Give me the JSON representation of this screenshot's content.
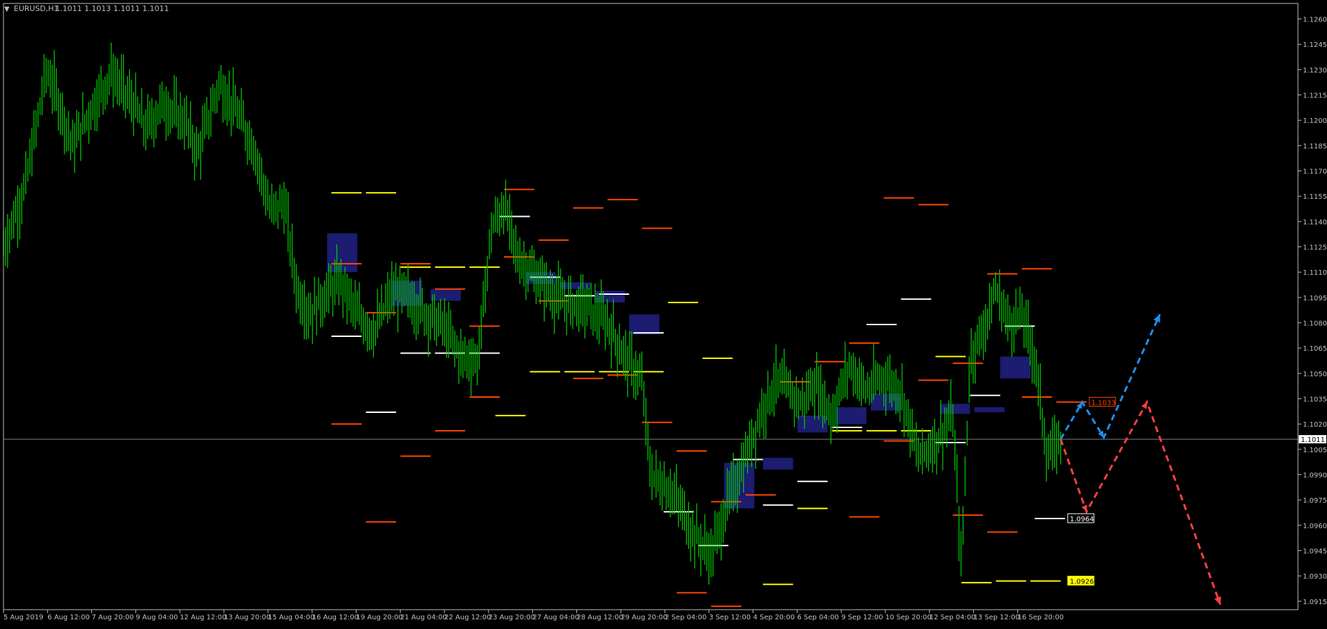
{
  "window": {
    "symbol_title": "EURUSD,H1",
    "ohlc_text": "1.1011 1.1013 1.1011 1.1011"
  },
  "colors": {
    "background": "#000000",
    "axis": "#c0c0c0",
    "candles": "#00c800",
    "bid_line": "#808080",
    "zone_fill": "#1c1c70",
    "level_orange": "#ff4500",
    "level_yellow": "#ffff00",
    "level_white": "#ffffff",
    "path_blue": "#1e8ff0",
    "path_red": "#ff4040"
  },
  "chart_data": {
    "type": "candlestick",
    "symbol": "EURUSD",
    "timeframe": "H1",
    "xlabel": "",
    "ylabel": "",
    "ylim": [
      1.091,
      1.1268
    ],
    "y_ticks": [
      "1.1260",
      "1.1245",
      "1.1230",
      "1.1215",
      "1.1200",
      "1.1185",
      "1.1170",
      "1.1155",
      "1.1140",
      "1.1125",
      "1.1110",
      "1.1095",
      "1.1080",
      "1.1065",
      "1.1050",
      "1.1035",
      "1.1020",
      "1.1005",
      "1.0990",
      "1.0975",
      "1.0960",
      "1.0945",
      "1.0930",
      "1.0915"
    ],
    "x_ticks": [
      "5 Aug 2019",
      "6 Aug 12:00",
      "7 Aug 20:00",
      "9 Aug 04:00",
      "12 Aug 12:00",
      "13 Aug 20:00",
      "15 Aug 04:00",
      "16 Aug 12:00",
      "19 Aug 20:00",
      "21 Aug 04:00",
      "22 Aug 12:00",
      "23 Aug 20:00",
      "27 Aug 04:00",
      "28 Aug 12:00",
      "29 Aug 20:00",
      "2 Sep 04:00",
      "3 Sep 12:00",
      "4 Sep 20:00",
      "6 Sep 04:00",
      "9 Sep 12:00",
      "10 Sep 20:00",
      "12 Sep 04:00",
      "13 Sep 12:00",
      "16 Sep 20:00"
    ],
    "x_range": [
      0,
      30
    ],
    "current_price": "1.1011",
    "price_path": [
      [
        0,
        1.1125
      ],
      [
        0.5,
        1.116
      ],
      [
        1.0,
        1.123
      ],
      [
        1.3,
        1.121
      ],
      [
        1.6,
        1.1185
      ],
      [
        2.0,
        1.1205
      ],
      [
        2.5,
        1.1228
      ],
      [
        3.0,
        1.121
      ],
      [
        3.3,
        1.1195
      ],
      [
        3.7,
        1.121
      ],
      [
        4.2,
        1.12
      ],
      [
        4.5,
        1.118
      ],
      [
        5.0,
        1.1222
      ],
      [
        5.4,
        1.1205
      ],
      [
        5.8,
        1.1185
      ],
      [
        6.2,
        1.1145
      ],
      [
        6.5,
        1.1152
      ],
      [
        6.8,
        1.11
      ],
      [
        7.1,
        1.1085
      ],
      [
        7.4,
        1.1095
      ],
      [
        7.8,
        1.1105
      ],
      [
        8.2,
        1.1085
      ],
      [
        8.6,
        1.1075
      ],
      [
        9.0,
        1.1098
      ],
      [
        9.4,
        1.1095
      ],
      [
        9.8,
        1.1085
      ],
      [
        10.2,
        1.1078
      ],
      [
        10.6,
        1.106
      ],
      [
        11.0,
        1.1058
      ],
      [
        11.3,
        1.1135
      ],
      [
        11.6,
        1.115
      ],
      [
        11.9,
        1.112
      ],
      [
        12.3,
        1.1108
      ],
      [
        12.7,
        1.1098
      ],
      [
        13.0,
        1.1092
      ],
      [
        13.5,
        1.109
      ],
      [
        14.0,
        1.108
      ],
      [
        14.4,
        1.106
      ],
      [
        14.8,
        1.1045
      ],
      [
        15.0,
        1.099
      ],
      [
        15.5,
        1.098
      ],
      [
        16.0,
        1.0955
      ],
      [
        16.4,
        1.0942
      ],
      [
        16.8,
        1.0975
      ],
      [
        17.2,
        1.1
      ],
      [
        17.6,
        1.103
      ],
      [
        17.9,
        1.1045
      ],
      [
        18.2,
        1.104
      ],
      [
        18.5,
        1.1032
      ],
      [
        18.8,
        1.1045
      ],
      [
        19.2,
        1.1025
      ],
      [
        19.6,
        1.1055
      ],
      [
        20.0,
        1.104
      ],
      [
        20.4,
        1.1048
      ],
      [
        20.8,
        1.104
      ],
      [
        21.2,
        1.1
      ],
      [
        21.6,
        1.101
      ],
      [
        22.0,
        1.1025
      ],
      [
        22.2,
        1.0935
      ],
      [
        22.4,
        1.106
      ],
      [
        22.7,
        1.1075
      ],
      [
        23.0,
        1.11
      ],
      [
        23.3,
        1.108
      ],
      [
        23.6,
        1.1085
      ],
      [
        23.9,
        1.106
      ],
      [
        24.2,
        1.1
      ],
      [
        24.5,
        1.1011
      ]
    ],
    "demand_supply_zones": [
      {
        "x0": 7.5,
        "x1": 8.2,
        "y0": 1.111,
        "y1": 1.1133
      },
      {
        "x0": 9.0,
        "x1": 9.7,
        "y0": 1.109,
        "y1": 1.1105
      },
      {
        "x0": 9.9,
        "x1": 10.6,
        "y0": 1.1093,
        "y1": 1.11
      },
      {
        "x0": 12.1,
        "x1": 12.8,
        "y0": 1.1103,
        "y1": 1.111
      },
      {
        "x0": 12.9,
        "x1": 13.6,
        "y0": 1.11,
        "y1": 1.1104
      },
      {
        "x0": 13.7,
        "x1": 14.4,
        "y0": 1.1092,
        "y1": 1.1099
      },
      {
        "x0": 14.5,
        "x1": 15.2,
        "y0": 1.1073,
        "y1": 1.1085
      },
      {
        "x0": 16.7,
        "x1": 17.4,
        "y0": 1.097,
        "y1": 1.0997
      },
      {
        "x0": 17.6,
        "x1": 18.3,
        "y0": 1.0993,
        "y1": 1.1
      },
      {
        "x0": 18.4,
        "x1": 19.1,
        "y0": 1.1015,
        "y1": 1.1025
      },
      {
        "x0": 19.3,
        "x1": 20.0,
        "y0": 1.102,
        "y1": 1.103
      },
      {
        "x0": 20.1,
        "x1": 20.8,
        "y0": 1.1028,
        "y1": 1.1038
      },
      {
        "x0": 21.7,
        "x1": 22.4,
        "y0": 1.1026,
        "y1": 1.1032
      },
      {
        "x0": 22.5,
        "x1": 23.2,
        "y0": 1.1027,
        "y1": 1.103
      },
      {
        "x0": 23.1,
        "x1": 23.8,
        "y0": 1.1047,
        "y1": 1.106
      }
    ],
    "levels": [
      {
        "color": "orange",
        "x0": 7.6,
        "x1": 8.3,
        "y": 1.1115
      },
      {
        "color": "orange",
        "x0": 7.6,
        "x1": 8.3,
        "y": 1.102
      },
      {
        "color": "orange",
        "x0": 8.4,
        "x1": 9.1,
        "y": 1.0962
      },
      {
        "color": "orange",
        "x0": 8.4,
        "x1": 9.1,
        "y": 1.1086
      },
      {
        "color": "orange",
        "x0": 9.2,
        "x1": 9.9,
        "y": 1.1115
      },
      {
        "color": "orange",
        "x0": 9.2,
        "x1": 9.9,
        "y": 1.1001
      },
      {
        "color": "orange",
        "x0": 10.0,
        "x1": 10.7,
        "y": 1.11
      },
      {
        "color": "orange",
        "x0": 10.0,
        "x1": 10.7,
        "y": 1.1016
      },
      {
        "color": "orange",
        "x0": 10.8,
        "x1": 11.5,
        "y": 1.1078
      },
      {
        "color": "orange",
        "x0": 10.8,
        "x1": 11.5,
        "y": 1.1036
      },
      {
        "color": "orange",
        "x0": 11.6,
        "x1": 12.3,
        "y": 1.1159
      },
      {
        "color": "orange",
        "x0": 11.6,
        "x1": 12.3,
        "y": 1.1119
      },
      {
        "color": "orange",
        "x0": 12.4,
        "x1": 13.1,
        "y": 1.1129
      },
      {
        "color": "orange",
        "x0": 12.4,
        "x1": 13.1,
        "y": 1.1093
      },
      {
        "color": "orange",
        "x0": 13.2,
        "x1": 13.9,
        "y": 1.1148
      },
      {
        "color": "orange",
        "x0": 13.2,
        "x1": 13.9,
        "y": 1.1047
      },
      {
        "color": "orange",
        "x0": 14.0,
        "x1": 14.7,
        "y": 1.1153
      },
      {
        "color": "orange",
        "x0": 14.0,
        "x1": 14.7,
        "y": 1.1049
      },
      {
        "color": "orange",
        "x0": 14.8,
        "x1": 15.5,
        "y": 1.1136
      },
      {
        "color": "orange",
        "x0": 14.8,
        "x1": 15.5,
        "y": 1.1021
      },
      {
        "color": "orange",
        "x0": 15.6,
        "x1": 16.3,
        "y": 1.1004
      },
      {
        "color": "orange",
        "x0": 15.6,
        "x1": 16.3,
        "y": 1.092
      },
      {
        "color": "orange",
        "x0": 16.4,
        "x1": 17.1,
        "y": 1.0974
      },
      {
        "color": "orange",
        "x0": 16.4,
        "x1": 17.1,
        "y": 1.0912
      },
      {
        "color": "orange",
        "x0": 17.2,
        "x1": 17.9,
        "y": 1.0978
      },
      {
        "color": "orange",
        "x0": 18.0,
        "x1": 18.7,
        "y": 1.1045
      },
      {
        "color": "orange",
        "x0": 18.8,
        "x1": 19.5,
        "y": 1.1057
      },
      {
        "color": "orange",
        "x0": 19.6,
        "x1": 20.3,
        "y": 1.1068
      },
      {
        "color": "orange",
        "x0": 19.6,
        "x1": 20.3,
        "y": 1.0965
      },
      {
        "color": "orange",
        "x0": 20.4,
        "x1": 21.1,
        "y": 1.1154
      },
      {
        "color": "orange",
        "x0": 20.4,
        "x1": 21.1,
        "y": 1.101
      },
      {
        "color": "orange",
        "x0": 21.2,
        "x1": 21.9,
        "y": 1.115
      },
      {
        "color": "orange",
        "x0": 21.2,
        "x1": 21.9,
        "y": 1.1046
      },
      {
        "color": "orange",
        "x0": 22.0,
        "x1": 22.7,
        "y": 1.1056
      },
      {
        "color": "orange",
        "x0": 22.0,
        "x1": 22.7,
        "y": 1.0966
      },
      {
        "color": "orange",
        "x0": 22.8,
        "x1": 23.5,
        "y": 1.1109
      },
      {
        "color": "orange",
        "x0": 22.8,
        "x1": 23.5,
        "y": 1.0956
      },
      {
        "color": "orange",
        "x0": 23.6,
        "x1": 24.3,
        "y": 1.1112
      },
      {
        "color": "orange",
        "x0": 23.6,
        "x1": 24.3,
        "y": 1.1036
      },
      {
        "color": "orange",
        "x0": 24.4,
        "x1": 25.1,
        "y": 1.1033
      },
      {
        "color": "yellow",
        "x0": 7.6,
        "x1": 8.3,
        "y": 1.1157
      },
      {
        "color": "yellow",
        "x0": 8.4,
        "x1": 9.1,
        "y": 1.1157
      },
      {
        "color": "yellow",
        "x0": 9.2,
        "x1": 9.9,
        "y": 1.1113
      },
      {
        "color": "yellow",
        "x0": 10.0,
        "x1": 10.7,
        "y": 1.1113
      },
      {
        "color": "yellow",
        "x0": 10.8,
        "x1": 11.5,
        "y": 1.1113
      },
      {
        "color": "yellow",
        "x0": 11.4,
        "x1": 12.1,
        "y": 1.1025
      },
      {
        "color": "yellow",
        "x0": 12.2,
        "x1": 12.9,
        "y": 1.1051
      },
      {
        "color": "yellow",
        "x0": 13.0,
        "x1": 13.7,
        "y": 1.1051
      },
      {
        "color": "yellow",
        "x0": 13.8,
        "x1": 14.5,
        "y": 1.1051
      },
      {
        "color": "yellow",
        "x0": 14.6,
        "x1": 15.3,
        "y": 1.1051
      },
      {
        "color": "yellow",
        "x0": 15.4,
        "x1": 16.1,
        "y": 1.1092
      },
      {
        "color": "yellow",
        "x0": 16.2,
        "x1": 16.9,
        "y": 1.1059
      },
      {
        "color": "yellow",
        "x0": 17.6,
        "x1": 18.3,
        "y": 1.0925
      },
      {
        "color": "yellow",
        "x0": 18.4,
        "x1": 19.1,
        "y": 1.097
      },
      {
        "color": "yellow",
        "x0": 19.2,
        "x1": 19.9,
        "y": 1.1016
      },
      {
        "color": "yellow",
        "x0": 20.0,
        "x1": 20.7,
        "y": 1.1016
      },
      {
        "color": "yellow",
        "x0": 20.8,
        "x1": 21.5,
        "y": 1.1016
      },
      {
        "color": "yellow",
        "x0": 21.6,
        "x1": 22.3,
        "y": 1.106
      },
      {
        "color": "yellow",
        "x0": 22.2,
        "x1": 22.9,
        "y": 1.0926
      },
      {
        "color": "yellow",
        "x0": 23.0,
        "x1": 23.7,
        "y": 1.0927
      },
      {
        "color": "yellow",
        "x0": 23.8,
        "x1": 24.5,
        "y": 1.0927
      },
      {
        "color": "white",
        "x0": 7.6,
        "x1": 8.3,
        "y": 1.1072
      },
      {
        "color": "white",
        "x0": 8.4,
        "x1": 9.1,
        "y": 1.1027
      },
      {
        "color": "white",
        "x0": 9.2,
        "x1": 9.9,
        "y": 1.1062
      },
      {
        "color": "white",
        "x0": 10.0,
        "x1": 10.7,
        "y": 1.1062
      },
      {
        "color": "white",
        "x0": 10.8,
        "x1": 11.5,
        "y": 1.1062
      },
      {
        "color": "white",
        "x0": 11.5,
        "x1": 12.2,
        "y": 1.1143
      },
      {
        "color": "white",
        "x0": 12.2,
        "x1": 12.9,
        "y": 1.1107
      },
      {
        "color": "white",
        "x0": 13.0,
        "x1": 13.7,
        "y": 1.1096
      },
      {
        "color": "white",
        "x0": 13.8,
        "x1": 14.5,
        "y": 1.1097
      },
      {
        "color": "white",
        "x0": 14.6,
        "x1": 15.3,
        "y": 1.1074
      },
      {
        "color": "white",
        "x0": 15.3,
        "x1": 16.0,
        "y": 1.0968
      },
      {
        "color": "white",
        "x0": 16.1,
        "x1": 16.8,
        "y": 1.0948
      },
      {
        "color": "white",
        "x0": 16.9,
        "x1": 17.6,
        "y": 1.0999
      },
      {
        "color": "white",
        "x0": 17.6,
        "x1": 18.3,
        "y": 1.0972
      },
      {
        "color": "white",
        "x0": 18.4,
        "x1": 19.1,
        "y": 1.0986
      },
      {
        "color": "white",
        "x0": 19.2,
        "x1": 19.9,
        "y": 1.1018
      },
      {
        "color": "white",
        "x0": 20.0,
        "x1": 20.7,
        "y": 1.1079
      },
      {
        "color": "white",
        "x0": 20.8,
        "x1": 21.5,
        "y": 1.1094
      },
      {
        "color": "white",
        "x0": 21.6,
        "x1": 22.3,
        "y": 1.1009
      },
      {
        "color": "white",
        "x0": 22.4,
        "x1": 23.1,
        "y": 1.1037
      },
      {
        "color": "white",
        "x0": 23.2,
        "x1": 23.9,
        "y": 1.1078
      },
      {
        "color": "white",
        "x0": 23.9,
        "x1": 24.6,
        "y": 1.0964
      }
    ],
    "price_labels": [
      {
        "text": "1.1033",
        "color": "orange",
        "x": 25.1,
        "y": 1.1033
      },
      {
        "text": "1.0964",
        "color": "white",
        "x": 24.6,
        "y": 1.0964
      },
      {
        "text": "1.0926",
        "color": "yellow",
        "x": 24.6,
        "y": 1.0927
      }
    ],
    "projection_blue": [
      [
        24.5,
        1.1011
      ],
      [
        25.0,
        1.1033
      ],
      [
        25.5,
        1.1012
      ],
      [
        26.8,
        1.1085
      ]
    ],
    "projection_red": [
      [
        24.5,
        1.1011
      ],
      [
        25.1,
        1.0968
      ],
      [
        26.5,
        1.1033
      ],
      [
        28.2,
        1.0913
      ]
    ]
  }
}
